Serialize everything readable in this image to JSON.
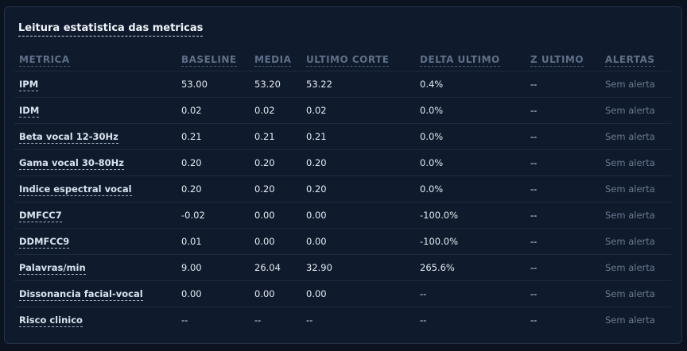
{
  "panel": {
    "title": "Leitura estatistica das metricas"
  },
  "table": {
    "headers": [
      "METRICA",
      "BASELINE",
      "MEDIA",
      "ULTIMO CORTE",
      "DELTA ULTIMO",
      "Z ULTIMO",
      "ALERTAS"
    ],
    "rows": [
      {
        "metric": "IPM",
        "baseline": "53.00",
        "media": "53.20",
        "ultimo_corte": "53.22",
        "delta_ultimo": "0.4%",
        "z_ultimo": "--",
        "alertas": "Sem alerta"
      },
      {
        "metric": "IDM",
        "baseline": "0.02",
        "media": "0.02",
        "ultimo_corte": "0.02",
        "delta_ultimo": "0.0%",
        "z_ultimo": "--",
        "alertas": "Sem alerta"
      },
      {
        "metric": "Beta vocal 12-30Hz",
        "baseline": "0.21",
        "media": "0.21",
        "ultimo_corte": "0.21",
        "delta_ultimo": "0.0%",
        "z_ultimo": "--",
        "alertas": "Sem alerta"
      },
      {
        "metric": "Gama vocal 30-80Hz",
        "baseline": "0.20",
        "media": "0.20",
        "ultimo_corte": "0.20",
        "delta_ultimo": "0.0%",
        "z_ultimo": "--",
        "alertas": "Sem alerta"
      },
      {
        "metric": "Indice espectral vocal",
        "baseline": "0.20",
        "media": "0.20",
        "ultimo_corte": "0.20",
        "delta_ultimo": "0.0%",
        "z_ultimo": "--",
        "alertas": "Sem alerta"
      },
      {
        "metric": "DMFCC7",
        "baseline": "-0.02",
        "media": "0.00",
        "ultimo_corte": "0.00",
        "delta_ultimo": "-100.0%",
        "z_ultimo": "--",
        "alertas": "Sem alerta"
      },
      {
        "metric": "DDMFCC9",
        "baseline": "0.01",
        "media": "0.00",
        "ultimo_corte": "0.00",
        "delta_ultimo": "-100.0%",
        "z_ultimo": "--",
        "alertas": "Sem alerta"
      },
      {
        "metric": "Palavras/min",
        "baseline": "9.00",
        "media": "26.04",
        "ultimo_corte": "32.90",
        "delta_ultimo": "265.6%",
        "z_ultimo": "--",
        "alertas": "Sem alerta"
      },
      {
        "metric": "Dissonancia facial-vocal",
        "baseline": "0.00",
        "media": "0.00",
        "ultimo_corte": "0.00",
        "delta_ultimo": "--",
        "z_ultimo": "--",
        "alertas": "Sem alerta"
      },
      {
        "metric": "Risco clinico",
        "baseline": "--",
        "media": "--",
        "ultimo_corte": "--",
        "delta_ultimo": "--",
        "z_ultimo": "--",
        "alertas": "Sem alerta"
      }
    ]
  },
  "colors": {
    "background": "#0b1220",
    "panel": "#0f1a2c",
    "text": "#e6ebf3",
    "header_text": "#5f6f88",
    "alert_text": "#6b7a92"
  }
}
